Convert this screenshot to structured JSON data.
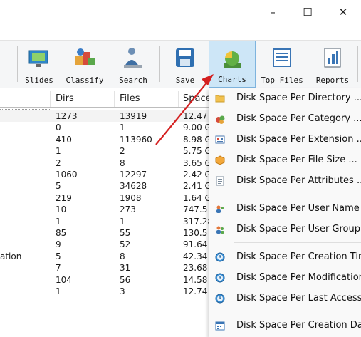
{
  "window": {
    "minimize_glyph": "–",
    "maximize_glyph": "☐",
    "close_glyph": "✕"
  },
  "toolbar": {
    "slides_label": "Slides",
    "classify_label": "Classify",
    "search_label": "Search",
    "save_label": "Save",
    "charts_label": "Charts",
    "topfiles_label": "Top Files",
    "reports_label": "Reports"
  },
  "table": {
    "columns": {
      "dirs": "Dirs",
      "files": "Files",
      "space": "Space"
    },
    "rows": [
      {
        "name": "",
        "dirs": "1273",
        "files": "13919",
        "space": "12.47"
      },
      {
        "name": "",
        "dirs": "0",
        "files": "1",
        "space": "9.00 G"
      },
      {
        "name": "",
        "dirs": "410",
        "files": "113960",
        "space": "8.98 G"
      },
      {
        "name": "",
        "dirs": "1",
        "files": "2",
        "space": "5.75 G"
      },
      {
        "name": "",
        "dirs": "2",
        "files": "8",
        "space": "3.65 G"
      },
      {
        "name": "",
        "dirs": "1060",
        "files": "12297",
        "space": "2.42 G"
      },
      {
        "name": "",
        "dirs": "5",
        "files": "34628",
        "space": "2.41 G"
      },
      {
        "name": "",
        "dirs": "219",
        "files": "1908",
        "space": "1.64 G"
      },
      {
        "name": "",
        "dirs": "10",
        "files": "273",
        "space": "747.5"
      },
      {
        "name": "",
        "dirs": "1",
        "files": "1",
        "space": "317.28"
      },
      {
        "name": "",
        "dirs": "85",
        "files": "55",
        "space": "130.5"
      },
      {
        "name": "",
        "dirs": "9",
        "files": "52",
        "space": "91.64"
      },
      {
        "name": "ation",
        "dirs": "5",
        "files": "8",
        "space": "42.34"
      },
      {
        "name": "",
        "dirs": "7",
        "files": "31",
        "space": "23.68"
      },
      {
        "name": "",
        "dirs": "104",
        "files": "56",
        "space": "14.58"
      },
      {
        "name": "",
        "dirs": "1",
        "files": "3",
        "space": "12.74"
      }
    ]
  },
  "charts_menu": {
    "items": [
      {
        "label": "Disk Space Per Directory ...",
        "icon": "folder-icon"
      },
      {
        "label": "Disk Space Per Category ...",
        "icon": "category-icon"
      },
      {
        "label": "Disk Space Per Extension ...",
        "icon": "extension-icon"
      },
      {
        "label": "Disk Space Per File Size ...",
        "icon": "file-size-icon"
      },
      {
        "label": "Disk Space Per Attributes ...",
        "icon": "attributes-icon"
      },
      {
        "label": "Disk Space Per User Name",
        "icon": "user-icon"
      },
      {
        "label": "Disk Space Per User Group",
        "icon": "user-group-icon"
      },
      {
        "label": "Disk Space Per Creation Tim",
        "icon": "clock-icon"
      },
      {
        "label": "Disk Space Per Modification",
        "icon": "clock-icon"
      },
      {
        "label": "Disk Space Per Last Access",
        "icon": "clock-icon"
      },
      {
        "label": "Disk Space Per Creation Da",
        "icon": "calendar-icon"
      }
    ]
  },
  "colors": {
    "accent": "#cde6f7",
    "arrow": "#d42020"
  }
}
